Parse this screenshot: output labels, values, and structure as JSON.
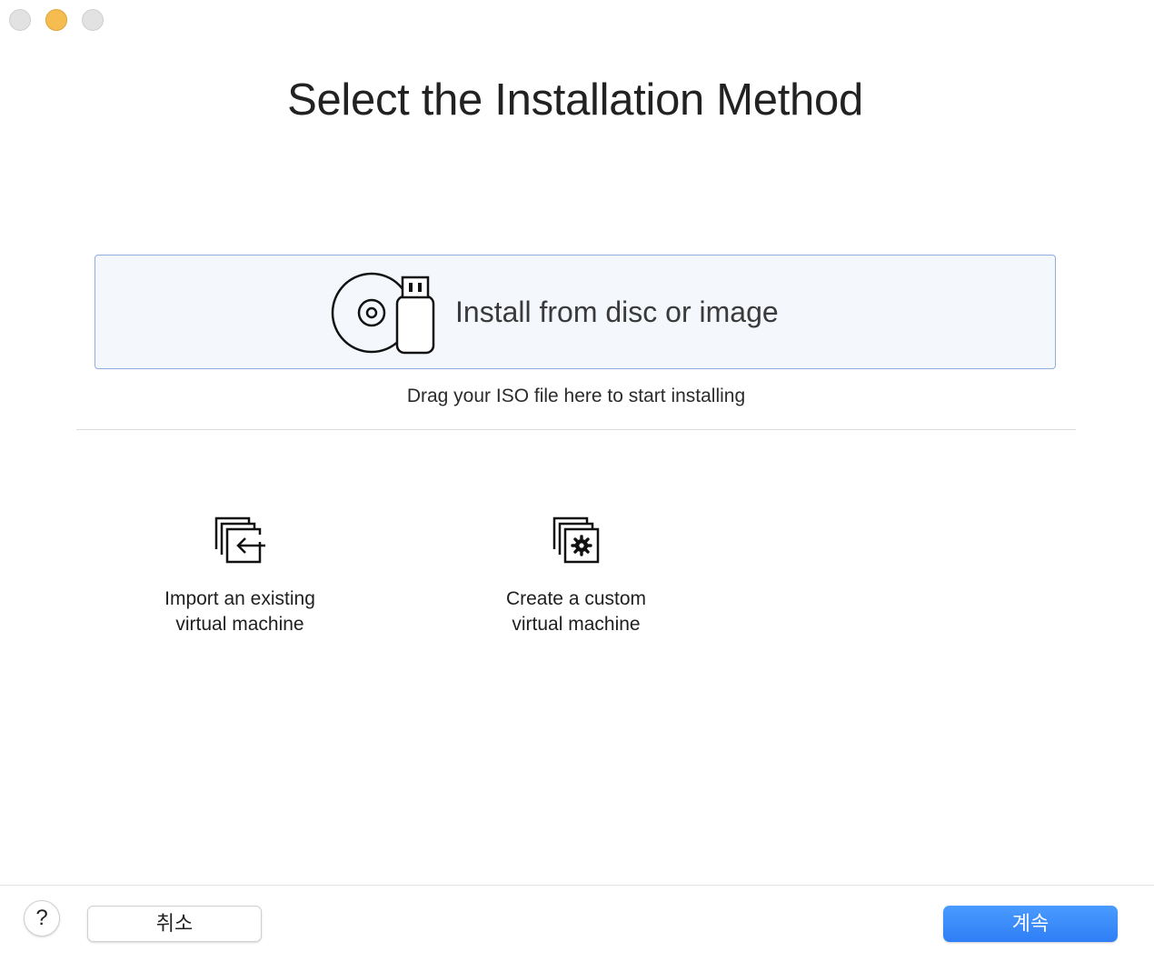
{
  "window": {
    "title": "Select the Installation Method"
  },
  "install": {
    "label": "Install from disc or image",
    "hint": "Drag your ISO file here to start installing",
    "icon": "disc-usb-icon"
  },
  "options": {
    "import": {
      "line1": "Import an existing",
      "line2": "virtual machine",
      "icon": "import-vm-icon"
    },
    "custom": {
      "line1": "Create a custom",
      "line2": "virtual machine",
      "icon": "custom-vm-icon"
    }
  },
  "footer": {
    "help_label": "?",
    "cancel_label": "취소",
    "continue_label": "계속"
  },
  "colors": {
    "accent": "#2f7ef6",
    "selection_bg": "#f4f7fc",
    "selection_border": "#8eaee0"
  }
}
